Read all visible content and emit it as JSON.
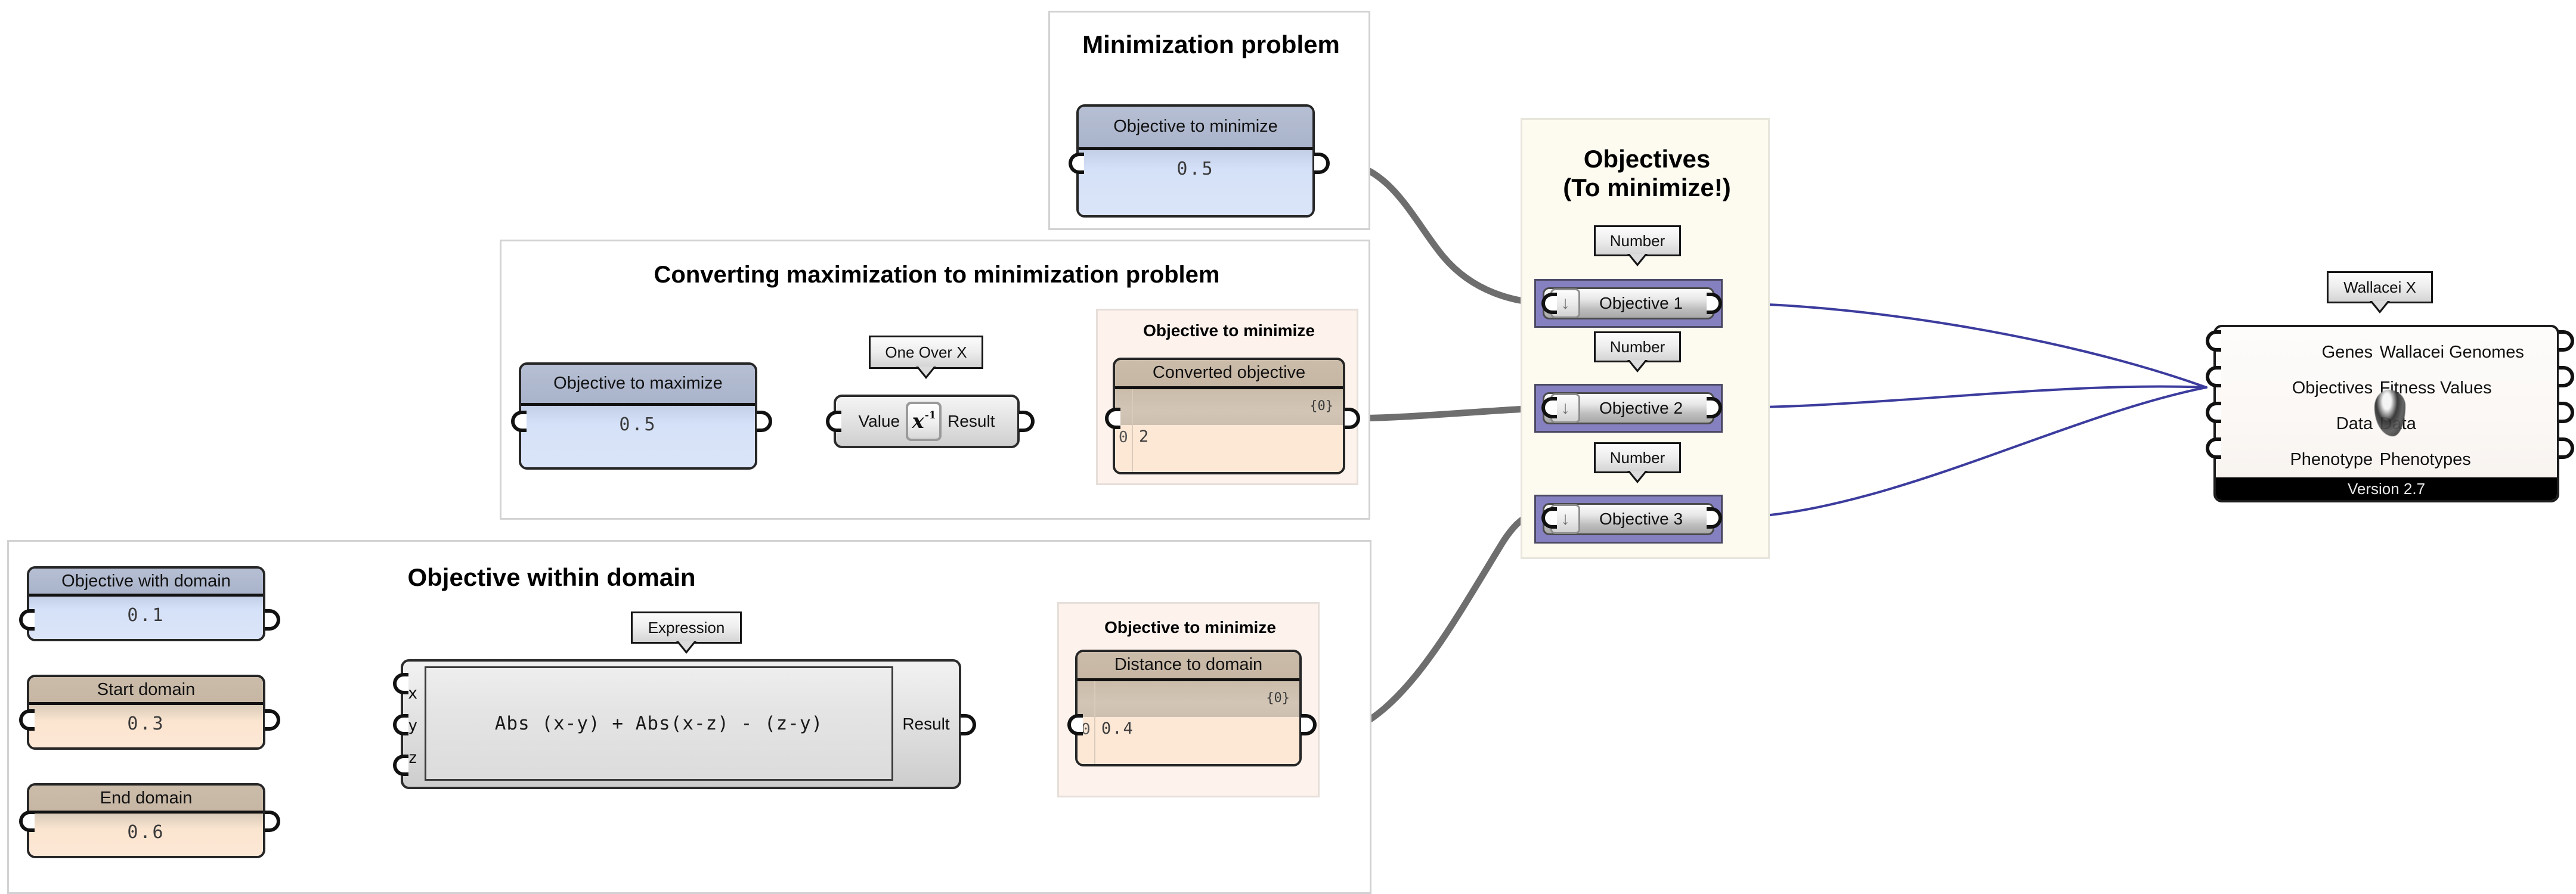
{
  "groups": {
    "minimization": {
      "title": "Minimization problem"
    },
    "converting": {
      "title": "Converting maximization to minimization problem",
      "inner_title": "Objective to minimize"
    },
    "objectives": {
      "title_line1": "Objectives",
      "title_line2": "(To minimize!)"
    },
    "within_domain": {
      "title": "Objective within domain",
      "inner_title": "Objective to minimize"
    }
  },
  "sliders": {
    "objective_to_minimize": {
      "label": "Objective to minimize",
      "value": "0.5"
    },
    "objective_to_maximize": {
      "label": "Objective to maximize",
      "value": "0.5"
    },
    "objective_with_domain": {
      "label": "Objective with domain",
      "value": "0.1"
    },
    "start_domain": {
      "label": "Start domain",
      "value": "0.3"
    },
    "end_domain": {
      "label": "End domain",
      "value": "0.6"
    }
  },
  "panels": {
    "converted_objective": {
      "label": "Converted objective",
      "path": "{0}",
      "row_index": "0",
      "row_value": "2"
    },
    "distance_to_domain": {
      "label": "Distance to domain",
      "path": "{0}",
      "row_index": "0",
      "row_value": "0.4"
    }
  },
  "one_over_x": {
    "nickname": "One Over X",
    "input_label": "Value",
    "output_label": "Result",
    "icon": "x-inverse-icon",
    "icon_base": "x",
    "icon_exp": "-1"
  },
  "expression": {
    "nickname": "Expression",
    "inputs": [
      "x",
      "y",
      "z"
    ],
    "formula": "Abs (x-y) + Abs(x-z) - (z-y)",
    "output_label": "Result"
  },
  "objective_components": [
    {
      "nickname": "Number",
      "label": "Objective 1",
      "icon": "down-arrow-icon",
      "icon_glyph": "↓"
    },
    {
      "nickname": "Number",
      "label": "Objective 2",
      "icon": "down-arrow-icon",
      "icon_glyph": "↓"
    },
    {
      "nickname": "Number",
      "label": "Objective 3",
      "icon": "down-arrow-icon",
      "icon_glyph": "↓"
    }
  ],
  "wallacei": {
    "nickname": "Wallacei X",
    "inputs": [
      "Genes",
      "Objectives",
      "Data",
      "Phenotype"
    ],
    "outputs": [
      "Wallacei Genomes",
      "Fitness Values",
      "Data",
      "Phenotypes"
    ],
    "version": "Version 2.7",
    "icon": "wallacei-ghost-icon"
  },
  "colors": {
    "slider_blue_cap": "#a9b3ca",
    "slider_blue_body": "#dbe5f9",
    "slider_tan_cap": "#c6b6a3",
    "slider_tan_body": "#fde8d6",
    "objective_purple": "#8580c0",
    "wire_grey": "#6e6e6e",
    "wire_blue": "#3c3c9e",
    "group_cream": "#fdfaf0",
    "group_peach": "#fdf2ec"
  }
}
